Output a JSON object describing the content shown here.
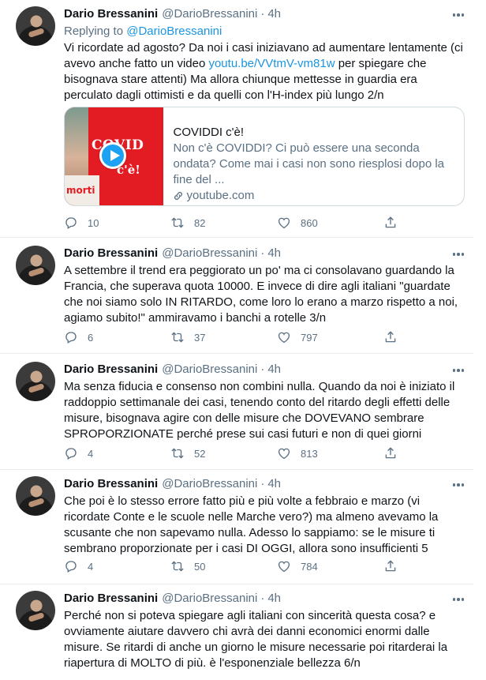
{
  "tweets": [
    {
      "name": "Dario Bressanini",
      "handle": "@DarioBressanini",
      "dot": "·",
      "time": "4h",
      "replying_prefix": "Replying to",
      "replying_handle": "@DarioBressanini",
      "text_1": "Vi ricordate ad agosto? Da noi i casi iniziavano ad aumentare lentamente (ci avevo anche fatto un video ",
      "link": "youtu.be/VVtmV-vm81w",
      "text_2": " per spiegare che bisognava stare attenti) Ma allora chiunque mettesse in guardia era perculato dagli ottimisti e da quelli con l'H-index più lungo 2/n",
      "card": {
        "title": "COVIDDI c'è!",
        "description": "Non c'è COVIDDI? Ci può essere una seconda ondata? Come mai i casi non sono riesplosi dopo la fine del ...",
        "domain": "youtube.com",
        "thumb_text_1": "COVID",
        "thumb_text_2": "c'è!",
        "thumb_text_3": "morti"
      },
      "replies": "10",
      "retweets": "82",
      "likes": "860"
    },
    {
      "name": "Dario Bressanini",
      "handle": "@DarioBressanini",
      "dot": "·",
      "time": "4h",
      "text": "A settembre il trend era peggiorato un po' ma ci consolavano guardando la Francia, che superava quota 10000. E invece di dire agli italiani \"guardate che noi siamo solo IN RITARDO, come loro lo erano a marzo rispetto a noi, agiamo subito!\" ammiravamo i banchi a rotelle 3/n",
      "replies": "6",
      "retweets": "37",
      "likes": "797"
    },
    {
      "name": "Dario Bressanini",
      "handle": "@DarioBressanini",
      "dot": "·",
      "time": "4h",
      "text": "Ma senza fiducia e consenso non combini nulla. Quando da noi è iniziato il raddoppio settimanale dei casi, tenendo conto del ritardo degli effetti delle misure, bisognava agire con delle misure che DOVEVANO sembrare SPROPORZIONATE perché prese sui casi futuri e non di quei giorni",
      "replies": "4",
      "retweets": "52",
      "likes": "813"
    },
    {
      "name": "Dario Bressanini",
      "handle": "@DarioBressanini",
      "dot": "·",
      "time": "4h",
      "text": "Che poi è lo stesso errore fatto più e più volte a febbraio e marzo (vi ricordate Conte e le scuole nelle Marche vero?) ma almeno avevamo la scusante che non sapevamo nulla. Adesso lo sappiamo: se le misure ti sembrano proporzionate per i casi DI OGGI, allora sono insufficienti 5",
      "replies": "4",
      "retweets": "50",
      "likes": "784"
    },
    {
      "name": "Dario Bressanini",
      "handle": "@DarioBressanini",
      "dot": "·",
      "time": "4h",
      "text": "Perché non si poteva spiegare agli italiani con sincerità questa cosa? e ovviamente aiutare davvero chi avrà dei danni economici enormi dalle misure. Se ritardi di anche un giorno le misure necessarie poi ritarderai la riapertura di MOLTO di più. è l'esponenziale bellezza 6/n"
    }
  ],
  "icons": {
    "reply": "reply-icon",
    "retweet": "retweet-icon",
    "like": "like-icon",
    "share": "share-icon",
    "more": "more-icon",
    "link": "link-icon"
  },
  "colors": {
    "link": "#1b95e0",
    "secondary_text": "#5b7083",
    "play_button": "#1da1f2",
    "thumbnail_red": "#e31b23"
  }
}
